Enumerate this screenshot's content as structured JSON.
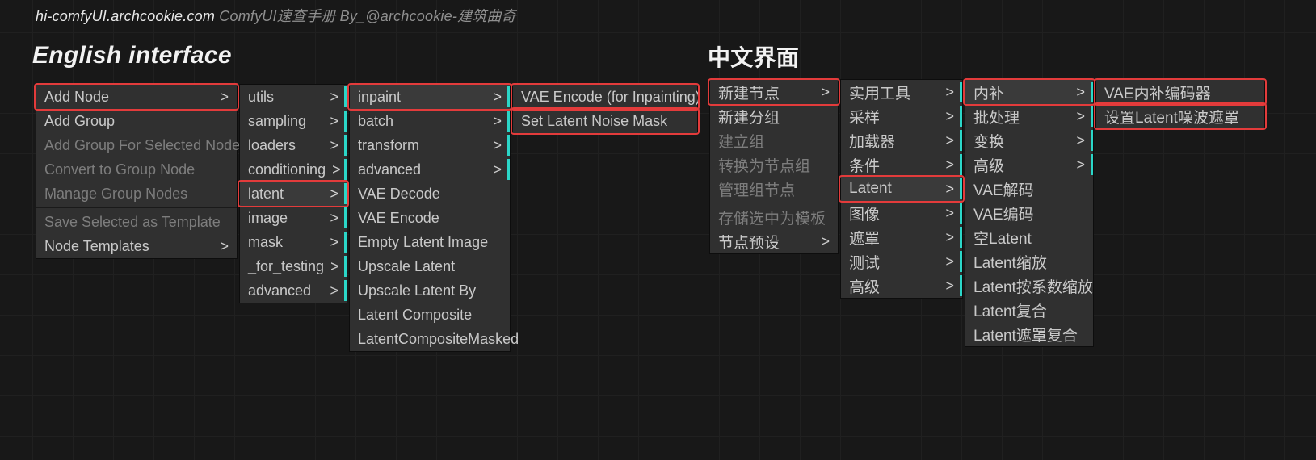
{
  "header": {
    "url": "hi-comfyUI.archcookie.com",
    "rest": " ComfyUI速查手册 By_@archcookie-建筑曲奇"
  },
  "titles": {
    "en": "English interface",
    "cn": "中文界面"
  },
  "en": {
    "menu1": [
      {
        "label": "Add Node",
        "arrow": true,
        "hl": true
      },
      {
        "label": "Add Group"
      },
      {
        "label": "Add Group For Selected Nodes",
        "dim": true
      },
      {
        "label": "Convert to Group Node",
        "dim": true
      },
      {
        "label": "Manage Group Nodes",
        "dim": true
      },
      {
        "sep": true
      },
      {
        "label": "Save Selected as Template",
        "dim": true
      },
      {
        "label": "Node Templates",
        "arrow": true
      }
    ],
    "menu2": [
      {
        "label": "utils",
        "arrow": true,
        "teal": true
      },
      {
        "label": "sampling",
        "arrow": true,
        "teal": true
      },
      {
        "label": "loaders",
        "arrow": true,
        "teal": true
      },
      {
        "label": "conditioning",
        "arrow": true,
        "teal": true
      },
      {
        "label": "latent",
        "arrow": true,
        "teal": true,
        "hl": true,
        "sel": true
      },
      {
        "label": "image",
        "arrow": true,
        "teal": true
      },
      {
        "label": "mask",
        "arrow": true,
        "teal": true
      },
      {
        "label": "_for_testing",
        "arrow": true,
        "teal": true
      },
      {
        "label": "advanced",
        "arrow": true,
        "teal": true
      }
    ],
    "menu3": [
      {
        "label": "inpaint",
        "arrow": true,
        "teal": true,
        "hl": true,
        "sel": true
      },
      {
        "label": "batch",
        "arrow": true,
        "teal": true
      },
      {
        "label": "transform",
        "arrow": true,
        "teal": true
      },
      {
        "label": "advanced",
        "arrow": true,
        "teal": true
      },
      {
        "label": "VAE Decode"
      },
      {
        "label": "VAE Encode"
      },
      {
        "label": "Empty Latent Image"
      },
      {
        "label": "Upscale Latent"
      },
      {
        "label": "Upscale Latent By"
      },
      {
        "label": "Latent Composite"
      },
      {
        "label": "LatentCompositeMasked"
      }
    ],
    "menu4": [
      {
        "label": "VAE Encode (for Inpainting)",
        "hl": true
      },
      {
        "label": "Set Latent Noise Mask",
        "hl": true
      }
    ]
  },
  "cn": {
    "menu1": [
      {
        "label": "新建节点",
        "arrow": true,
        "hl": true
      },
      {
        "label": "新建分组"
      },
      {
        "label": "建立组",
        "dim": true
      },
      {
        "label": "转换为节点组",
        "dim": true
      },
      {
        "label": "管理组节点",
        "dim": true
      },
      {
        "sep": true
      },
      {
        "label": "存储选中为模板",
        "dim": true
      },
      {
        "label": "节点预设",
        "arrow": true
      }
    ],
    "menu2": [
      {
        "label": "实用工具",
        "arrow": true,
        "teal": true
      },
      {
        "label": "采样",
        "arrow": true,
        "teal": true
      },
      {
        "label": "加载器",
        "arrow": true,
        "teal": true
      },
      {
        "label": "条件",
        "arrow": true,
        "teal": true
      },
      {
        "label": "Latent",
        "arrow": true,
        "teal": true,
        "hl": true,
        "sel": true
      },
      {
        "label": "图像",
        "arrow": true,
        "teal": true
      },
      {
        "label": "遮罩",
        "arrow": true,
        "teal": true
      },
      {
        "label": "测试",
        "arrow": true,
        "teal": true
      },
      {
        "label": "高级",
        "arrow": true,
        "teal": true
      }
    ],
    "menu3": [
      {
        "label": "内补",
        "arrow": true,
        "teal": true,
        "hl": true,
        "sel": true
      },
      {
        "label": "批处理",
        "arrow": true,
        "teal": true
      },
      {
        "label": "变换",
        "arrow": true,
        "teal": true
      },
      {
        "label": "高级",
        "arrow": true,
        "teal": true
      },
      {
        "label": "VAE解码"
      },
      {
        "label": "VAE编码"
      },
      {
        "label": "空Latent"
      },
      {
        "label": "Latent缩放"
      },
      {
        "label": "Latent按系数缩放"
      },
      {
        "label": "Latent复合"
      },
      {
        "label": "Latent遮罩复合"
      }
    ],
    "menu4": [
      {
        "label": "VAE内补编码器",
        "hl": true
      },
      {
        "label": "设置Latent噪波遮罩",
        "hl": true
      }
    ]
  }
}
